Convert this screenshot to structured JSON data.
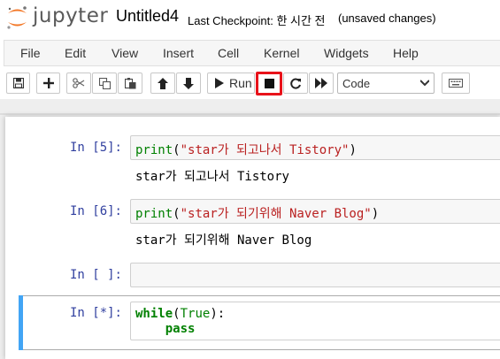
{
  "header": {
    "brand": "jupyter",
    "notebook_title": "Untitled4",
    "checkpoint": "Last Checkpoint: 한 시간 전",
    "autosave": "(unsaved changes)"
  },
  "menu": [
    "File",
    "Edit",
    "View",
    "Insert",
    "Cell",
    "Kernel",
    "Widgets",
    "Help"
  ],
  "toolbar": {
    "run_label": "Run",
    "cell_type": "Code",
    "buttons": [
      "save-icon",
      "plus-icon",
      "scissors-icon",
      "copy-icon",
      "paste-icon",
      "arrow-up-icon",
      "arrow-down-icon",
      "play-icon",
      "stop-icon",
      "restart-icon",
      "fast-forward-icon",
      "keyboard-icon"
    ],
    "highlighted_button": "interrupt-kernel-button",
    "highlight_color": "#e8121a"
  },
  "cells": [
    {
      "prompt": "In [5]:",
      "code": {
        "fn": "print",
        "open": "(",
        "str": "\"star가 되고나서 Tistory\"",
        "close": ")"
      },
      "output": "star가 되고나서 Tistory"
    },
    {
      "prompt": "In [6]:",
      "code": {
        "fn": "print",
        "open": "(",
        "str": "\"star가 되기위해 Naver Blog\"",
        "close": ")"
      },
      "output": "star가 되기위해 Naver Blog"
    },
    {
      "prompt": "In [ ]:",
      "code": "",
      "output": ""
    },
    {
      "prompt": "In [*]:",
      "code": {
        "kw": "while",
        "open": "(",
        "val": "True",
        "close": "):",
        "line2_indent": "    ",
        "line2_kw": "pass"
      },
      "output": ""
    }
  ],
  "colors": {
    "prompt": "#303f9f",
    "keyword": "#008000",
    "string": "#ba2121",
    "active_cell": "#42a5f5",
    "logo_orange": "#f37726"
  }
}
